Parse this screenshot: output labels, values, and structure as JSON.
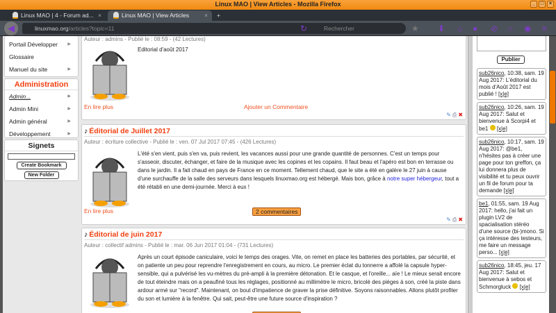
{
  "window": {
    "title": "Linux MAO | View Articles - Mozilla Firefox"
  },
  "tabs": [
    {
      "label": "Linux MAO | 4 - Forum ad...",
      "close": "×"
    },
    {
      "label": "Linux MAO | View Articles",
      "close": "×"
    }
  ],
  "new_tab": "+",
  "nav": {
    "url_host": "linuxmao.org",
    "url_path": "/articles?topic=11",
    "search_placeholder": "Rechercher"
  },
  "left_menu": {
    "items": [
      "Portail Développer",
      "Glossaire",
      "Manuel du site"
    ],
    "admin_title": "Administration",
    "admin_items": [
      "Admin...",
      "Admin Mini",
      "Admin général",
      "Développement"
    ],
    "signets_title": "Signets",
    "create_bookmark": "Create Bookmark",
    "new_folder": "New Folder"
  },
  "articles": [
    {
      "title": "",
      "meta": "Auteur : admins - Publié le : 08:59 - (42 Lectures)",
      "body": "Editorial d'août 2017",
      "read_more": "En lire plus",
      "comment": "Ajouter un Commentaire"
    },
    {
      "title": "Éditorial de Juillet 2017",
      "meta": "Auteur : écriture collective - Publié le : ven. 07 Jul 2017 07:45 - (426 Lectures)",
      "body": "L'été s'en vient, puis s'en va, puis revient, les vacances aussi pour une grande quantité de personnes. C'est un temps pour s'asseoir, discuter, échanger, et faire de la musique avec les copines et les copains. Il faut beau et l'apéro est bon en terrasse ou dans le jardin. Il a fait chaud en pays de France en ce moment. Tellement chaud, que le site a été en galère le 27 juin à cause d'une surchauffe de la salle des serveurs dans lesquels linuxmao.org est hébergé. Mais bon, grâce à ",
      "body_link": "notre super hébergeur",
      "body_end": ", tout a été rétabli en une demi-journée. Merci à eux !",
      "read_more": "En lire plus",
      "comment": "2 commentaires"
    },
    {
      "title": "Éditorial de juin 2017",
      "meta": "Auteur : collectif admins - Publié le : mar. 06 Jun 2017 01:04 - (731 Lectures)",
      "body": "Après un court épisode caniculaire, voici le temps des orages. Vite, on remet en place les batteries des portables, par sécurité, et on patiente un peu pour reprendre l'enregistrement en cours, au micro. Le premier éclat du tonnerre a affolé la capsule hyper-sensible, qui a pulvérisé les vu-mètres du pré-ampli à la première détonation. Et le casque, et l'oreille... aïe ! Le mieux serait encore de tout éteindre mais on a peaufiné tous les réglages, positionné au millimètre le micro, bricolé des pièges à son, créé la piste dans ardour armé sur \"record\". Maintenant, on bout d'impatience de graver la prise définitive. Soyons raisonnables. Allons plutôt profiter du son et lumière à la fenêtre. Qui sait, peut-être une future source d'inspiration ?"
    }
  ],
  "shoutbox": {
    "publish": "Publier",
    "messages": [
      {
        "user": "sub26nico",
        "text": ", 10:38, sam. 19 Aug 2017: L'éditorial du mois d'Août 2017 est publié ! ",
        "x": "[x|e]"
      },
      {
        "user": "sub26nico",
        "text": ", 10:26, sam. 19 Aug 2017: Salut et bienvenue à Scorpi4 et be1 ",
        "x": "[x|e]"
      },
      {
        "user": "sub26nico",
        "text": ", 10:17, sam. 19 Aug 2017: @be1, n'hésites pas à créer une page pour ton greffon, ça lui donnera plus de visibilité et tu peux ouvrir un fil de forum pour ta demande ",
        "x": "[x|e]"
      },
      {
        "user": "be1",
        "text": ", 01:55, sam. 19 Aug 2017: hello, j'ai fait un plugin LV2 de spacialisation stéréo d'une source (bi-)mono. Si ça intéresse des testeurs, me faire un message perso... ",
        "x": "[x|e]"
      },
      {
        "user": "sub26nico",
        "text": ", 18:45, jeu. 17 Aug 2017: Salut et bienvenue à sebos et Schmorgluck ",
        "x": "[x|e]"
      }
    ]
  }
}
